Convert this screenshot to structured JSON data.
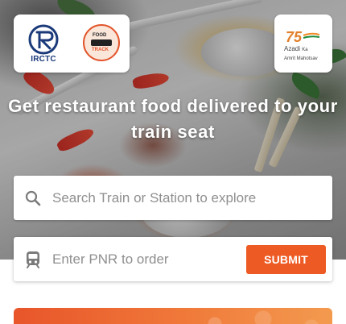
{
  "header": {
    "irctc_logo_text": "IRCTC",
    "foodtrack_logo_text": [
      "FOOD",
      "TRACK"
    ],
    "azadi_logo_number": "75",
    "azadi_logo_text": [
      "Azadi",
      "Ka",
      "Amrit Mahotsav"
    ]
  },
  "hero": {
    "headline": "Get restaurant food delivered to your train seat"
  },
  "search": {
    "placeholder": "Search Train or Station to explore",
    "icon": "search-icon"
  },
  "pnr": {
    "placeholder": "Enter PNR to order",
    "icon": "train-icon",
    "submit_label": "SUBMIT"
  },
  "colors": {
    "accent": "#ee5a24",
    "irctc_blue": "#1b3a7a",
    "banner_start": "#e8552a",
    "banner_end": "#f39a4f"
  }
}
